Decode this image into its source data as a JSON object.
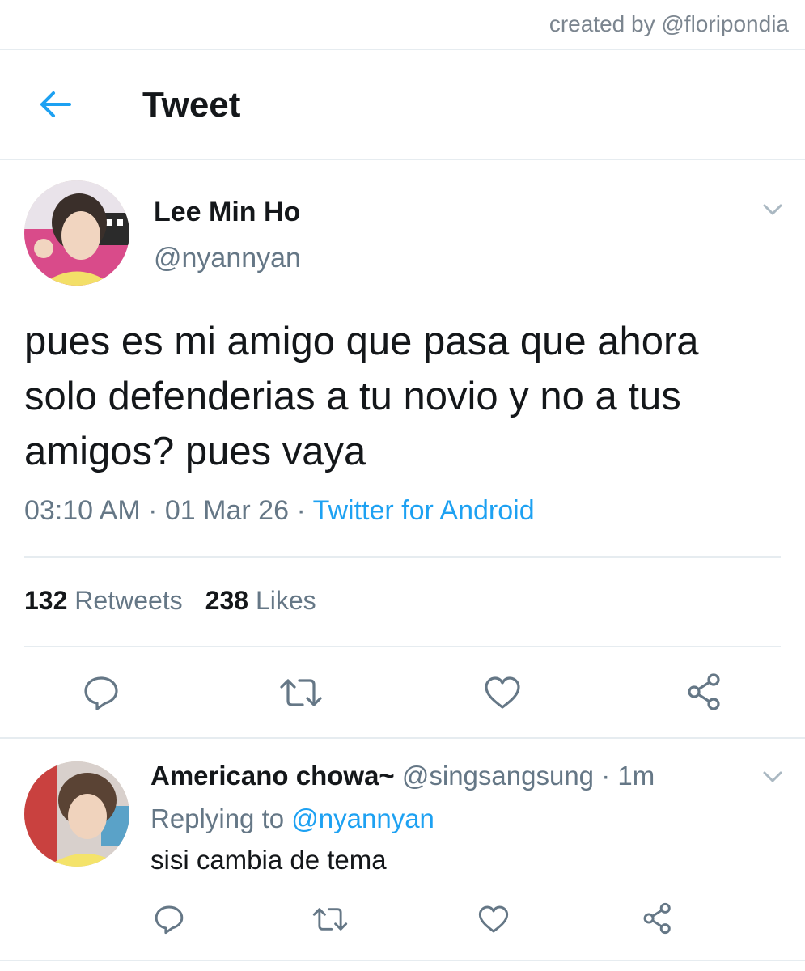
{
  "credit": "created by @floripondia",
  "header": {
    "title": "Tweet",
    "back_icon": "arrow-left-icon",
    "accent": "#1da1f2"
  },
  "tweet": {
    "author_name": "Lee Min Ho",
    "author_handle": "@nyannyan",
    "text": "pues es mi amigo que pasa que ahora solo defenderias a tu novio y no a tus amigos? pues vaya",
    "time": "03:10 AM",
    "date": "01 Mar 26",
    "source": "Twitter for Android",
    "retweets_count": "132",
    "retweets_label": "Retweets",
    "likes_count": "238",
    "likes_label": "Likes",
    "actions": [
      "reply-icon",
      "retweet-icon",
      "like-icon",
      "share-icon"
    ]
  },
  "reply": {
    "author_name": "Americano chowa~",
    "author_handle": "@singsangsung",
    "time": "1m",
    "replying_prefix": "Replying to",
    "replying_to": "@nyannyan",
    "text": "sisi cambia de tema",
    "actions": [
      "reply-icon",
      "retweet-icon",
      "like-icon",
      "share-icon"
    ]
  },
  "colors": {
    "text": "#14171a",
    "secondary": "#657786",
    "divider": "#e6ecf0",
    "link": "#1da1f2"
  }
}
